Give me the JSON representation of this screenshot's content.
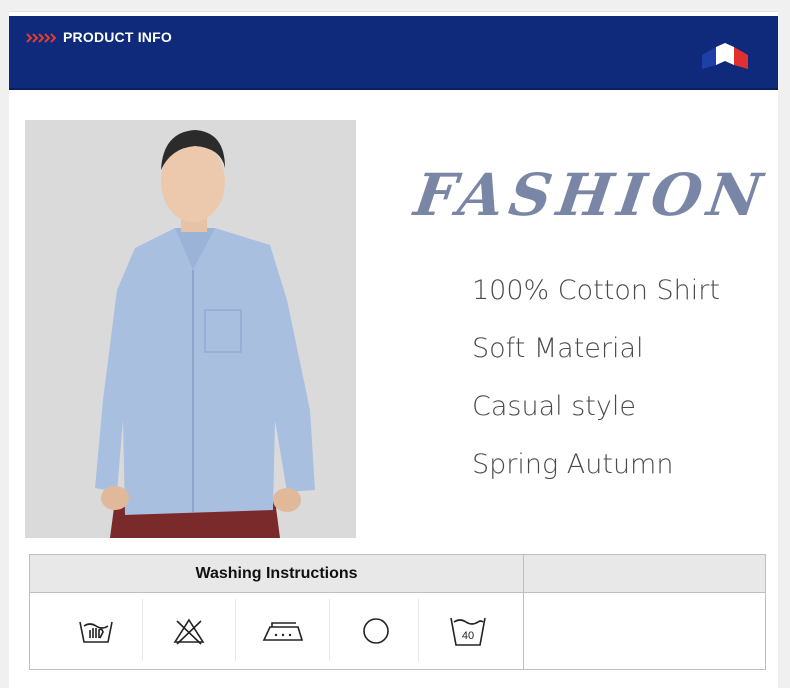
{
  "header": {
    "title": "PRODUCT INFO",
    "background_color": "#0f2a7a",
    "chevron_icon": "triple-chevron-right-icon",
    "flag_icon": "french-flag-icon"
  },
  "product_image": {
    "icon": "model-photo"
  },
  "banner": {
    "word": "FASHION",
    "color": "#7a86a6"
  },
  "features": [
    "100% Cotton Shirt",
    "Soft Material",
    "Casual style",
    "Spring Autumn"
  ],
  "washing": {
    "heading": "Washing Instructions",
    "icons": [
      {
        "name": "hand-wash-icon"
      },
      {
        "name": "do-not-bleach-icon"
      },
      {
        "name": "iron-icon"
      },
      {
        "name": "dry-clean-icon"
      },
      {
        "name": "wash-40-icon",
        "label": "40"
      }
    ]
  }
}
